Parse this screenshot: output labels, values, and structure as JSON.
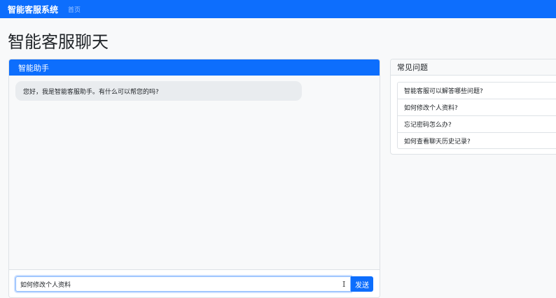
{
  "navbar": {
    "brand": "智能客服系统",
    "links": [
      {
        "label": "首页"
      }
    ]
  },
  "page": {
    "title": "智能客服聊天"
  },
  "chat": {
    "header": "智能助手",
    "messages": [
      {
        "role": "assistant",
        "text": "您好，我是智能客服助手。有什么可以帮您的吗?"
      }
    ],
    "input_value": "如何修改个人资料",
    "send_label": "发送"
  },
  "faq": {
    "header": "常见问题",
    "items": [
      {
        "label": "智能客服可以解答哪些问题?"
      },
      {
        "label": "如何修改个人资料?"
      },
      {
        "label": "忘记密码怎么办?"
      },
      {
        "label": "如何查看聊天历史记录?"
      }
    ]
  },
  "colors": {
    "primary": "#0d6efd",
    "bubble": "#e9ecef",
    "background": "#f8f9fa"
  },
  "icons": {
    "text_cursor": "text-cursor-icon"
  }
}
